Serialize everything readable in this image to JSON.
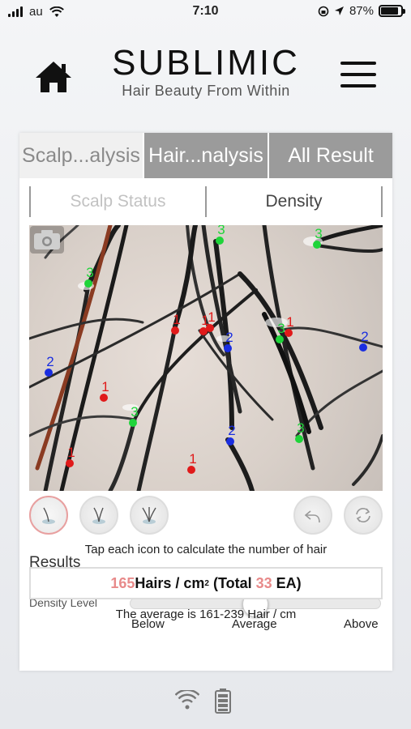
{
  "status_bar": {
    "carrier": "au",
    "time": "7:10",
    "battery_percent": "87%",
    "battery_level": 0.87
  },
  "header": {
    "title": "SUBLIMIC",
    "subtitle": "Hair Beauty From Within"
  },
  "tabs": [
    {
      "label": "Scalp...alysis",
      "active": true
    },
    {
      "label": "Hair...nalysis",
      "active": false
    },
    {
      "label": "All Result",
      "active": false
    }
  ],
  "subtabs": [
    {
      "label": "Scalp Status",
      "selected": false
    },
    {
      "label": "Density",
      "selected": true
    }
  ],
  "markers": {
    "colors": {
      "1": "#e01a1a",
      "2": "#1a2ee0",
      "3": "#1fd43a"
    },
    "labels": [
      "1",
      "1",
      "1",
      "1",
      "1",
      "1",
      "1",
      "1",
      "1",
      "2",
      "2",
      "2",
      "2",
      "2",
      "3",
      "3",
      "3",
      "3",
      "3",
      "3"
    ]
  },
  "instruction": "Tap each icon to calculate the number of hair",
  "results": {
    "title": "Results",
    "density_value": "165",
    "density_unit": " Hairs / cm",
    "density_exp": "2",
    "total_prefix": " (Total ",
    "total_value": "33",
    "total_suffix": " EA)",
    "density_label": "Density Level",
    "average_note": "The average is 161-239 Hair / cm",
    "level_fraction": 0.5,
    "scale": [
      "Below",
      "Average",
      "Above"
    ]
  }
}
